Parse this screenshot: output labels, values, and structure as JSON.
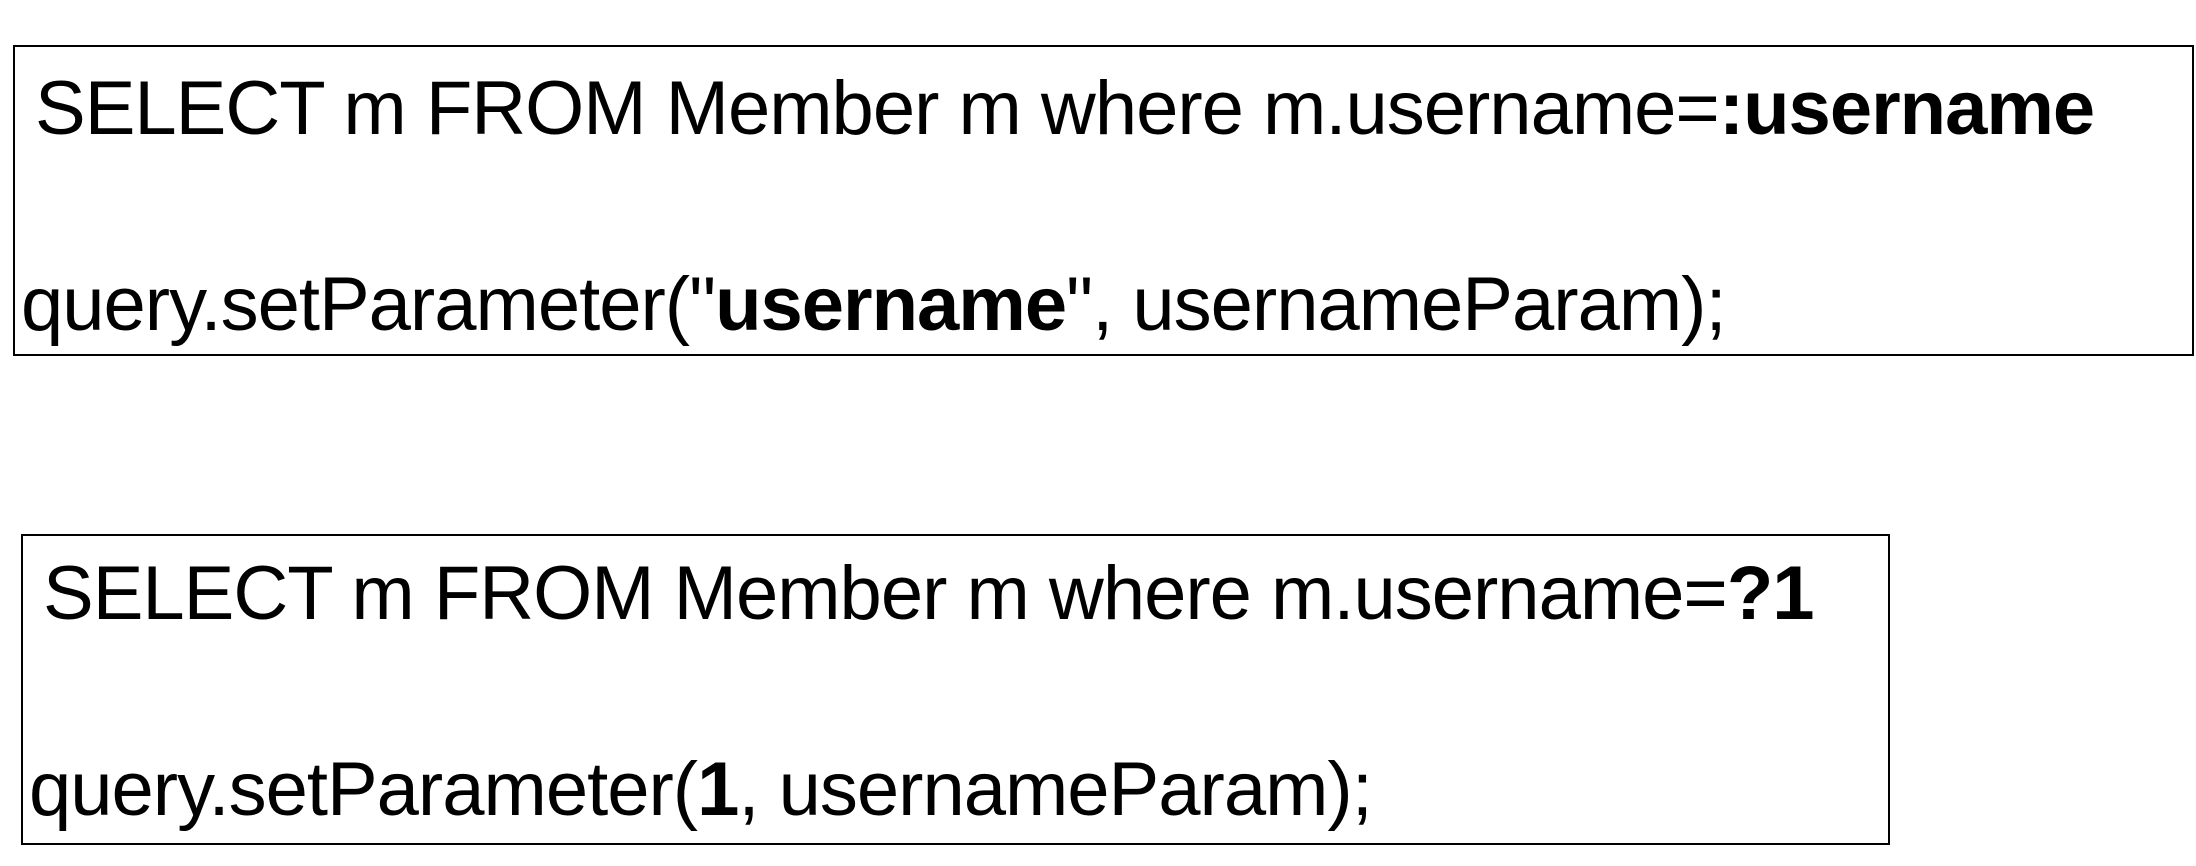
{
  "named_param_example": {
    "query": {
      "prefix": "SELECT m FROM Member m where m.username=",
      "param": ":username"
    },
    "set_parameter": {
      "prefix": "query.setParameter(\"",
      "param": "username",
      "suffix": "\", usernameParam);"
    }
  },
  "positional_param_example": {
    "query": {
      "prefix": "SELECT m FROM Member m where m.username=",
      "param": "?1"
    },
    "set_parameter": {
      "prefix": "query.setParameter(",
      "param": "1",
      "suffix": ", usernameParam);"
    }
  }
}
